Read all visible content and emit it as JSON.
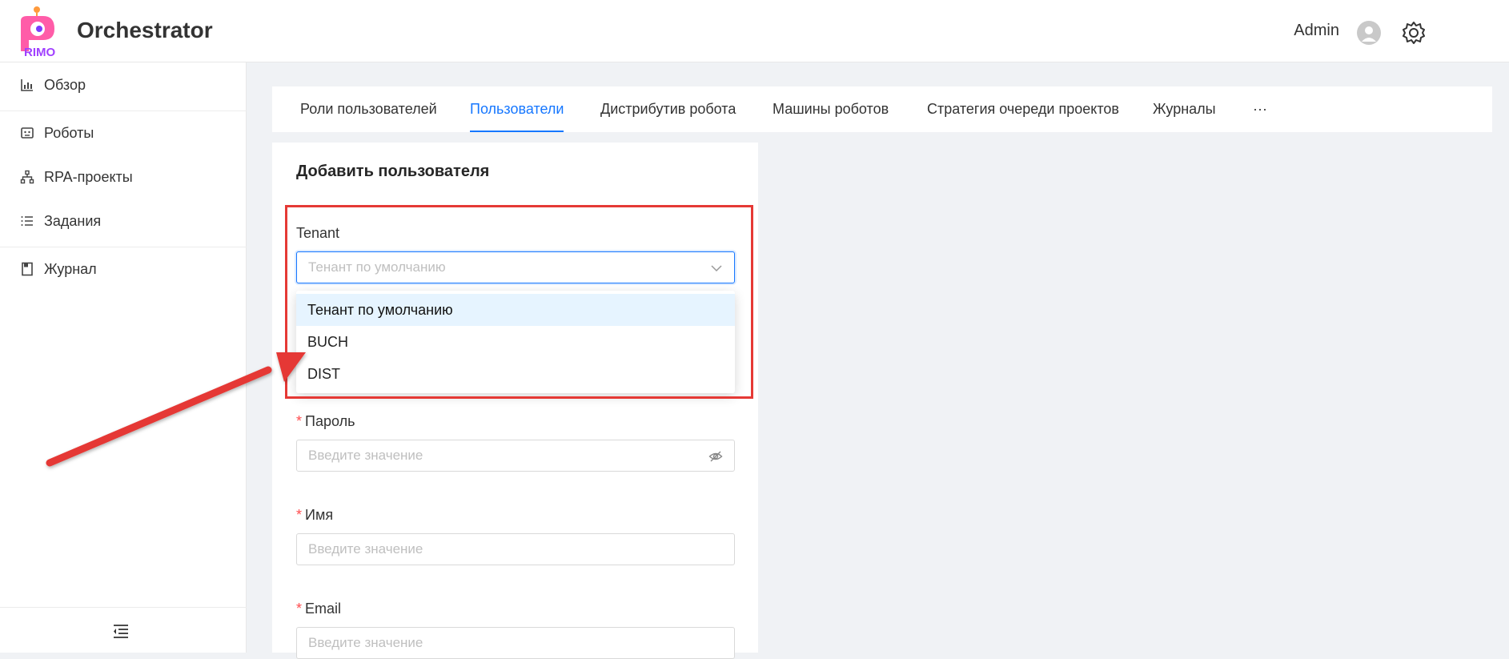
{
  "header": {
    "logo_text": "RIMO",
    "app_title": "Orchestrator",
    "user_name": "Admin",
    "avatar_icon": "user-avatar-icon",
    "settings_icon": "gear-icon"
  },
  "sidebar": {
    "items": [
      {
        "label": "Обзор",
        "icon": "bar-chart-icon"
      },
      {
        "label": "Роботы",
        "icon": "robot-icon"
      },
      {
        "label": "RPA-проекты",
        "icon": "hierarchy-icon"
      },
      {
        "label": "Задания",
        "icon": "list-icon"
      },
      {
        "label": "Журнал",
        "icon": "book-icon"
      }
    ],
    "collapse_icon": "menu-fold-icon"
  },
  "tabs": [
    {
      "label": "Роли пользователей",
      "active": false
    },
    {
      "label": "Пользователи",
      "active": true
    },
    {
      "label": "Дистрибутив робота",
      "active": false
    },
    {
      "label": "Машины роботов",
      "active": false
    },
    {
      "label": "Стратегия очереди проектов",
      "active": false
    },
    {
      "label": "Журналы",
      "active": false
    },
    {
      "label": "···",
      "active": false
    }
  ],
  "form": {
    "title": "Добавить пользователя",
    "tenant": {
      "label": "Tenant",
      "placeholder": "Тенант по умолчанию",
      "options": [
        "Тенант по умолчанию",
        "BUCH",
        "DIST"
      ],
      "highlighted_option": "Тенант по умолчанию"
    },
    "password": {
      "label": "Пароль",
      "required_mark": "*",
      "placeholder": "Введите значение"
    },
    "first_name": {
      "label": "Имя",
      "required_mark": "*",
      "placeholder": "Введите значение"
    },
    "email": {
      "label": "Email",
      "required_mark": "*",
      "placeholder": "Введите значение"
    }
  },
  "annotation": {
    "box_color": "#e53935",
    "arrow_color": "#e53935"
  },
  "colors": {
    "accent": "#1677ff",
    "required": "#ff4d4f"
  }
}
